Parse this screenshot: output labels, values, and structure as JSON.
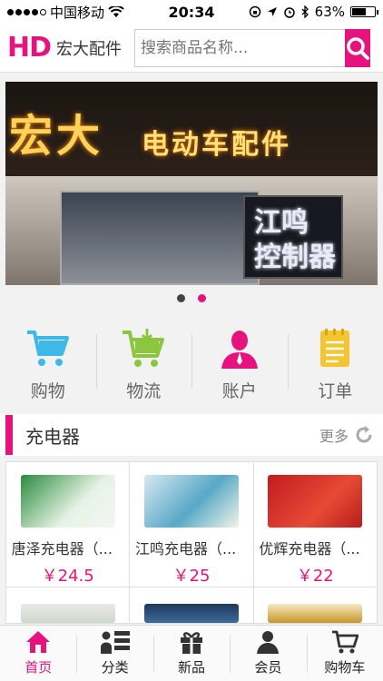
{
  "status_bar": {
    "carrier": "中国移动",
    "time": "20:34",
    "battery": "63%",
    "battery_level": 0.63
  },
  "header": {
    "logo_short": "HD",
    "logo_name": "宏大配件",
    "search_placeholder": "搜索商品名称..."
  },
  "banner": {
    "sign_big": "宏大",
    "sign_text": "电动车配件",
    "led_line1": "江鸣",
    "led_line2": "控制器",
    "slides": 2,
    "active_slide": 2
  },
  "quick_nav": [
    {
      "label": "购物",
      "icon": "shopping-cart-icon",
      "color": "#3db8e8"
    },
    {
      "label": "物流",
      "icon": "logistics-cart-icon",
      "color": "#8cc63e"
    },
    {
      "label": "账户",
      "icon": "account-icon",
      "color": "#e6127d"
    },
    {
      "label": "订单",
      "icon": "order-list-icon",
      "color": "#f5c431"
    }
  ],
  "section": {
    "title": "充电器",
    "more_label": "更多"
  },
  "products": [
    {
      "name": "唐泽充电器（...",
      "price": "￥24.5"
    },
    {
      "name": "江鸣充电器（...",
      "price": "￥25"
    },
    {
      "name": "优辉充电器（...",
      "price": "￥22"
    }
  ],
  "tabbar": [
    {
      "label": "首页",
      "icon": "home-icon",
      "active": true
    },
    {
      "label": "分类",
      "icon": "category-icon",
      "active": false
    },
    {
      "label": "新品",
      "icon": "gift-icon",
      "active": false
    },
    {
      "label": "会员",
      "icon": "member-icon",
      "active": false
    },
    {
      "label": "购物车",
      "icon": "cart-icon",
      "active": false
    }
  ],
  "colors": {
    "brand": "#e6127d"
  }
}
